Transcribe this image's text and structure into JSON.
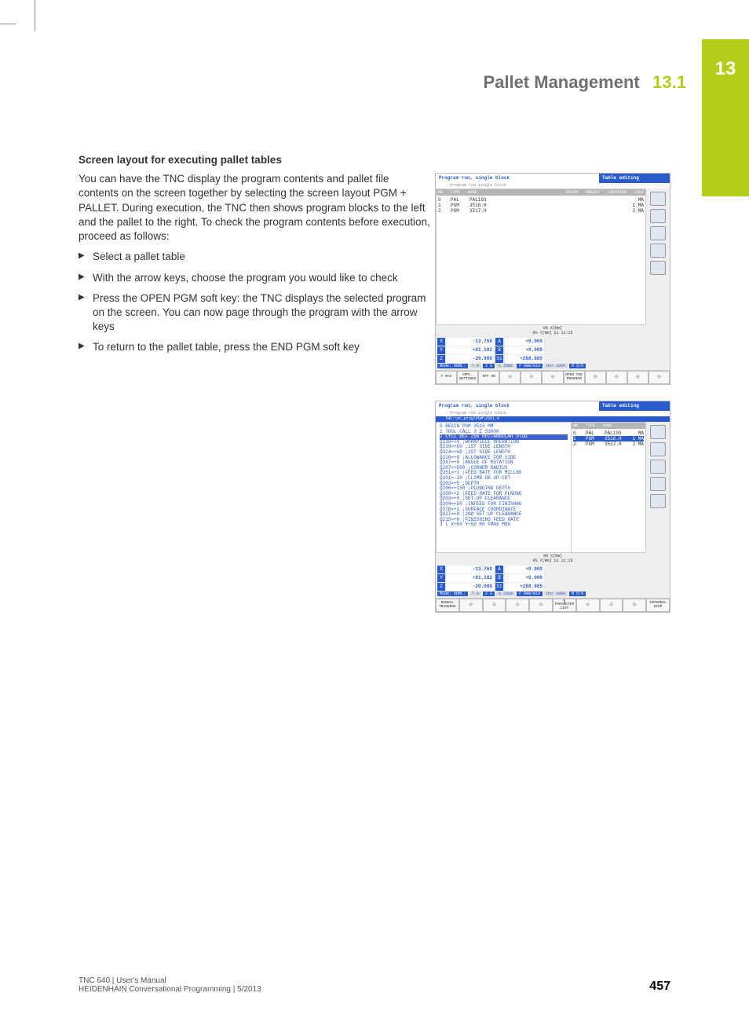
{
  "chapter_tab": "13",
  "header": {
    "title": "Pallet Management",
    "section": "13.1"
  },
  "body": {
    "heading": "Screen layout for executing pallet tables",
    "paragraph": "You can have the TNC display the program contents and pallet file contents on the screen together by selecting the screen layout PGM + PALLET. During execution, the TNC then shows program blocks to the left and the pallet to the right. To check the program contents before execution, proceed as follows:",
    "bullets": [
      "Select a pallet table",
      "With the arrow keys, choose the program you would like to check",
      "Press the OPEN PGM soft key: the TNC displays the selected program on the screen. You can now page through the program with the arrow keys",
      "To return to the pallet table, press the END PGM soft key"
    ]
  },
  "fig_common": {
    "title_left": "Program run, single block",
    "title_sub": "→ Program run single block",
    "title_right": "Table editing",
    "table_header": [
      "NR",
      "TYPE",
      "NAME",
      "DATUM",
      "PRESET",
      "LOCATION",
      "LOCK"
    ],
    "table_rows": [
      {
        "nr": "0",
        "type": "PAL",
        "name": "PAL193",
        "datum": "",
        "preset": "",
        "loc": "MA",
        "lock": ""
      },
      {
        "nr": "1",
        "type": "PGM",
        "name": "3516.H",
        "datum": "",
        "preset": "1",
        "loc": "MA",
        "lock": ""
      },
      {
        "nr": "2",
        "type": "PGM",
        "name": "3517.H",
        "datum": "",
        "preset": "2",
        "loc": "MA",
        "lock": ""
      }
    ],
    "status_lines": [
      "0% X[Nm]",
      "0% Y[Nm] S1  11:15"
    ],
    "axes": [
      {
        "l": "X",
        "v": "-13.769",
        "l2": "A",
        "v2": "+0.000"
      },
      {
        "l": "Y",
        "v": "+81.182",
        "l2": "B",
        "v2": "+0.000"
      },
      {
        "l": "Z",
        "v": "-20.000",
        "l2": "S1",
        "v2": "+288.885"
      }
    ],
    "modebar": [
      "Mode: NOML.",
      "T 0",
      "Z S",
      "S 2500",
      "F 0mm/min",
      "Ovr 100%",
      "M 5/9"
    ]
  },
  "fig1": {
    "softkeys": [
      "F MAX",
      "APPL. SETTINGS",
      "OFF ON",
      "",
      "",
      "",
      "OPEN THE PROGRAM",
      "",
      "",
      "",
      ""
    ]
  },
  "fig2": {
    "path": "TNC:\\nc_prog\\PGM\\2561.H",
    "code": [
      "0 BEGIN PGM 3516 MM",
      "1 TOOL CALL 3 Z S3000",
      "2 CYCL DEF 256 RECTANGULAR STUD",
      "   Q218=+0    ;WORKPIECE OPERATION",
      "   Q219=+60   ;1ST SIDE LENGTH",
      "   Q424=+60   ;1ST SIDE LENGTH",
      "   Q220=+0    ;ALLOWANCE FOR SIDE",
      "   Q367=+0    ;ANGLE OF ROTATION",
      "   Q207=+500  ;CORNER RADIUS",
      "   Q351=+1    ;FEED RATE FOR MILLNG",
      "   Q201=-20   ;CLIMB OR UP-CUT",
      "   Q202=+5    ;DEPTH",
      "   Q206=+150  ;PLUNGING DEPTH",
      "   Q200=+2    ;FEED RATE FOR PLNGNG",
      "   Q203=+0    ;SET-UP CLEARANCE",
      "   Q204=+50   ;INFEED FOR FINISHNG",
      "   Q370=+1    ;SURFACE COORDINATE",
      "   Q437=+0    ;2ND SET-UP CLEARANCE",
      "   Q215=+0    ;FINISHING FEED RATE",
      "3 L X+50 Y+50 R0 FMAX M99"
    ],
    "softkeys": [
      "MANUAL TRAVERSE",
      "",
      "",
      "",
      "",
      "Q PARAMETER LIST",
      "",
      "",
      "",
      "INTERNAL STOP"
    ]
  },
  "footer": {
    "line1": "TNC 640 | User's Manual",
    "line2": "HEIDENHAIN Conversational Programming | 5/2013",
    "page": "457"
  }
}
